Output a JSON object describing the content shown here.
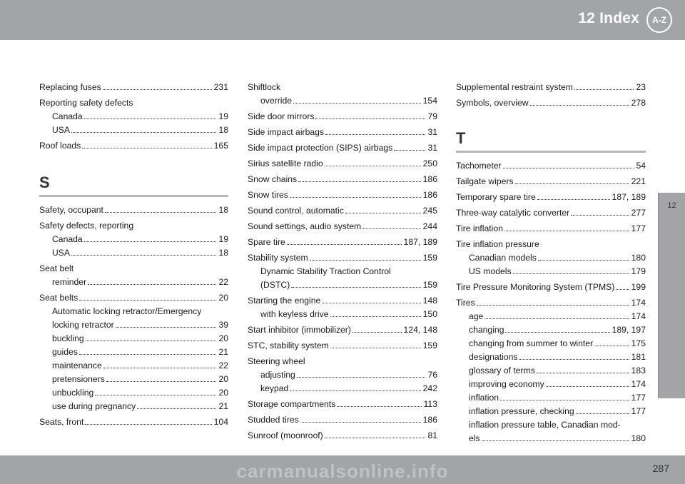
{
  "header": {
    "title": "12 Index",
    "icon_text": "A-Z"
  },
  "chapter_tab": "12",
  "footer": {
    "page_number": "287",
    "watermark": "carmanualsonline.info"
  },
  "columns": {
    "col1": {
      "e0": {
        "term": "Replacing fuses",
        "page": "231"
      },
      "e1": {
        "head": "Reporting safety defects",
        "s0": {
          "term": "Canada",
          "page": "19"
        },
        "s1": {
          "term": "USA",
          "page": "18"
        }
      },
      "e2": {
        "term": "Roof loads",
        "page": "165"
      },
      "letter_s": "S",
      "e3": {
        "term": "Safety, occupant",
        "page": "18"
      },
      "e4": {
        "head": "Safety defects, reporting",
        "s0": {
          "term": "Canada",
          "page": "19"
        },
        "s1": {
          "term": "USA",
          "page": "18"
        }
      },
      "e5": {
        "head": "Seat belt",
        "s0": {
          "term": "reminder",
          "page": "22"
        }
      },
      "e6": {
        "term": "Seat belts",
        "page": "20",
        "sub_text": "Automatic locking retractor/Emergency",
        "s0": {
          "term": "locking retractor",
          "page": "39"
        },
        "s1": {
          "term": "buckling",
          "page": "20"
        },
        "s2": {
          "term": "guides",
          "page": "21"
        },
        "s3": {
          "term": "maintenance",
          "page": "22"
        },
        "s4": {
          "term": "pretensioners",
          "page": "20"
        },
        "s5": {
          "term": "unbuckling",
          "page": "20"
        },
        "s6": {
          "term": "use during pregnancy",
          "page": "21"
        }
      },
      "e7": {
        "term": "Seats, front",
        "page": "104"
      }
    },
    "col2": {
      "e0": {
        "head": "Shiftlock",
        "s0": {
          "term": "override",
          "page": "154"
        }
      },
      "e1": {
        "term": "Side door mirrors",
        "page": "79"
      },
      "e2": {
        "term": "Side impact airbags",
        "page": "31"
      },
      "e3": {
        "term": "Side impact protection (SIPS) airbags",
        "page": "31"
      },
      "e4": {
        "term": "Sirius satellite radio",
        "page": "250"
      },
      "e5": {
        "term": "Snow chains",
        "page": "186"
      },
      "e6": {
        "term": "Snow tires",
        "page": "186"
      },
      "e7": {
        "term": "Sound control, automatic",
        "page": "245"
      },
      "e8": {
        "term": "Sound settings, audio system",
        "page": "244"
      },
      "e9": {
        "term": "Spare tire",
        "page": "187, 189"
      },
      "e10": {
        "term": "Stability system",
        "page": "159",
        "sub_text": "Dynamic Stability Traction Control",
        "s0": {
          "term": "(DSTC)",
          "page": "159"
        }
      },
      "e11": {
        "term": "Starting the engine",
        "page": "148",
        "s0": {
          "term": "with keyless drive",
          "page": "150"
        }
      },
      "e12": {
        "term": "Start inhibitor (immobilizer)",
        "page": "124, 148"
      },
      "e13": {
        "term": "STC, stability system",
        "page": "159"
      },
      "e14": {
        "head": "Steering wheel",
        "s0": {
          "term": "adjusting",
          "page": "76"
        },
        "s1": {
          "term": "keypad",
          "page": "242"
        }
      },
      "e15": {
        "term": "Storage compartments",
        "page": "113"
      },
      "e16": {
        "term": "Studded tires",
        "page": "186"
      },
      "e17": {
        "term": "Sunroof (moonroof)",
        "page": "81"
      }
    },
    "col3": {
      "e0": {
        "term": "Supplemental restraint system",
        "page": "23"
      },
      "e1": {
        "term": "Symbols, overview",
        "page": "278"
      },
      "letter_t": "T",
      "e2": {
        "term": "Tachometer",
        "page": "54"
      },
      "e3": {
        "term": "Tailgate wipers",
        "page": "221"
      },
      "e4": {
        "term": "Temporary spare tire",
        "page": "187, 189"
      },
      "e5": {
        "term": "Three-way catalytic converter",
        "page": "277"
      },
      "e6": {
        "term": "Tire inflation",
        "page": "177"
      },
      "e7": {
        "head": "Tire inflation pressure",
        "s0": {
          "term": "Canadian models",
          "page": "180"
        },
        "s1": {
          "term": "US models",
          "page": "179"
        }
      },
      "e8": {
        "term": "Tire Pressure Monitoring System (TPMS)",
        "page": "199"
      },
      "e9": {
        "term": "Tires",
        "page": "174",
        "s0": {
          "term": "age",
          "page": "174"
        },
        "s1": {
          "term": "changing",
          "page": "189, 197"
        },
        "s2": {
          "term": "changing from summer to winter",
          "page": "175"
        },
        "s3": {
          "term": "designations",
          "page": "181"
        },
        "s4": {
          "term": "glossary of terms",
          "page": "183"
        },
        "s5": {
          "term": "improving economy",
          "page": "174"
        },
        "s6": {
          "term": "inflation",
          "page": "177"
        },
        "s7": {
          "term": "inflation pressure, checking",
          "page": "177"
        },
        "sub_text": "inflation pressure table, Canadian mod-",
        "s8": {
          "term": "els",
          "page": "180"
        }
      }
    }
  }
}
